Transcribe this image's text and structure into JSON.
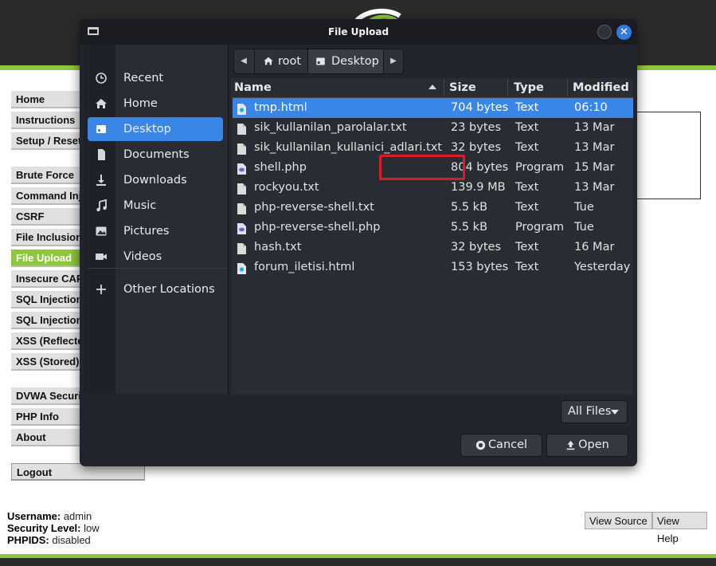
{
  "dvwa": {
    "menu": [
      {
        "label": "Home",
        "active": false
      },
      {
        "label": "Instructions",
        "active": false
      },
      {
        "label": "Setup / Reset",
        "active": false
      },
      {
        "label": "Brute Force",
        "active": false
      },
      {
        "label": "Command Inj",
        "active": false
      },
      {
        "label": "CSRF",
        "active": false
      },
      {
        "label": "File Inclusion",
        "active": false
      },
      {
        "label": "File Upload",
        "active": true
      },
      {
        "label": "Insecure CAP",
        "active": false
      },
      {
        "label": "SQL Injection",
        "active": false
      },
      {
        "label": "SQL Injection",
        "active": false
      },
      {
        "label": "XSS (Reflecte",
        "active": false
      },
      {
        "label": "XSS (Stored)",
        "active": false
      },
      {
        "label": "DVWA Securi",
        "active": false
      },
      {
        "label": "PHP Info",
        "active": false
      },
      {
        "label": "About",
        "active": false
      },
      {
        "label": "Logout",
        "active": false
      }
    ],
    "info": {
      "username_label": "Username:",
      "username": "admin",
      "security_label": "Security Level:",
      "security": "low",
      "phpids_label": "PHPIDS:",
      "phpids": "disabled"
    },
    "view_source": "View Source",
    "view_help": "View Help",
    "accent_color": "#8ec63f"
  },
  "dialog": {
    "title": "File Upload",
    "sidebar": [
      {
        "label": "Recent",
        "icon": "clock-icon"
      },
      {
        "label": "Home",
        "icon": "home-icon"
      },
      {
        "label": "Desktop",
        "icon": "desktop-icon",
        "active": true
      },
      {
        "label": "Documents",
        "icon": "document-icon"
      },
      {
        "label": "Downloads",
        "icon": "download-icon"
      },
      {
        "label": "Music",
        "icon": "music-icon"
      },
      {
        "label": "Pictures",
        "icon": "picture-icon"
      },
      {
        "label": "Videos",
        "icon": "video-icon"
      },
      {
        "label": "Other Locations",
        "icon": "plus-icon"
      }
    ],
    "path": {
      "root": "root",
      "current": "Desktop"
    },
    "columns": {
      "name": "Name",
      "size": "Size",
      "type": "Type",
      "modified": "Modified"
    },
    "files": [
      {
        "name": "tmp.html",
        "size": "704 bytes",
        "type": "Text",
        "modified": "06:10",
        "icon": "html",
        "selected": true
      },
      {
        "name": "sik_kullanilan_parolalar.txt",
        "size": "23 bytes",
        "type": "Text",
        "modified": "13 Mar",
        "icon": "text"
      },
      {
        "name": "sik_kullanilan_kullanici_adlari.txt",
        "size": "32 bytes",
        "type": "Text",
        "modified": "13 Mar",
        "icon": "text"
      },
      {
        "name": "shell.php",
        "size": "804 bytes",
        "type": "Program",
        "modified": "15 Mar",
        "icon": "php"
      },
      {
        "name": "rockyou.txt",
        "size": "139.9 MB",
        "type": "Text",
        "modified": "13 Mar",
        "icon": "text"
      },
      {
        "name": "php-reverse-shell.txt",
        "size": "5.5 kB",
        "type": "Text",
        "modified": "Tue",
        "icon": "text"
      },
      {
        "name": "php-reverse-shell.php",
        "size": "5.5 kB",
        "type": "Program",
        "modified": "Tue",
        "icon": "php"
      },
      {
        "name": "hash.txt",
        "size": "32 bytes",
        "type": "Text",
        "modified": "16 Mar",
        "icon": "text"
      },
      {
        "name": "forum_iletisi.html",
        "size": "153 bytes",
        "type": "Text",
        "modified": "Yesterday",
        "icon": "html"
      }
    ],
    "filter": "All Files",
    "cancel": "Cancel",
    "open": "Open",
    "selection_color": "#3a86e6",
    "highlight_color": "#d81d2a"
  }
}
